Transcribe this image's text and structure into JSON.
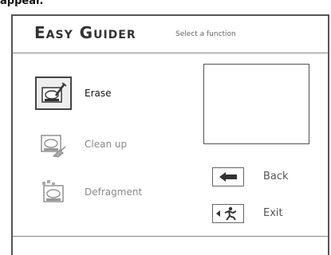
{
  "caption": "appear.",
  "header": {
    "title": "Easy Guider",
    "subtitle": "Select a function"
  },
  "functions": [
    {
      "label": "Erase",
      "icon": "erase-icon",
      "state": "selected"
    },
    {
      "label": "Clean up",
      "icon": "cleanup-icon",
      "state": "disabled"
    },
    {
      "label": "Defragment",
      "icon": "defragment-icon",
      "state": "disabled"
    }
  ],
  "nav": {
    "back_label": "Back",
    "exit_label": "Exit"
  }
}
